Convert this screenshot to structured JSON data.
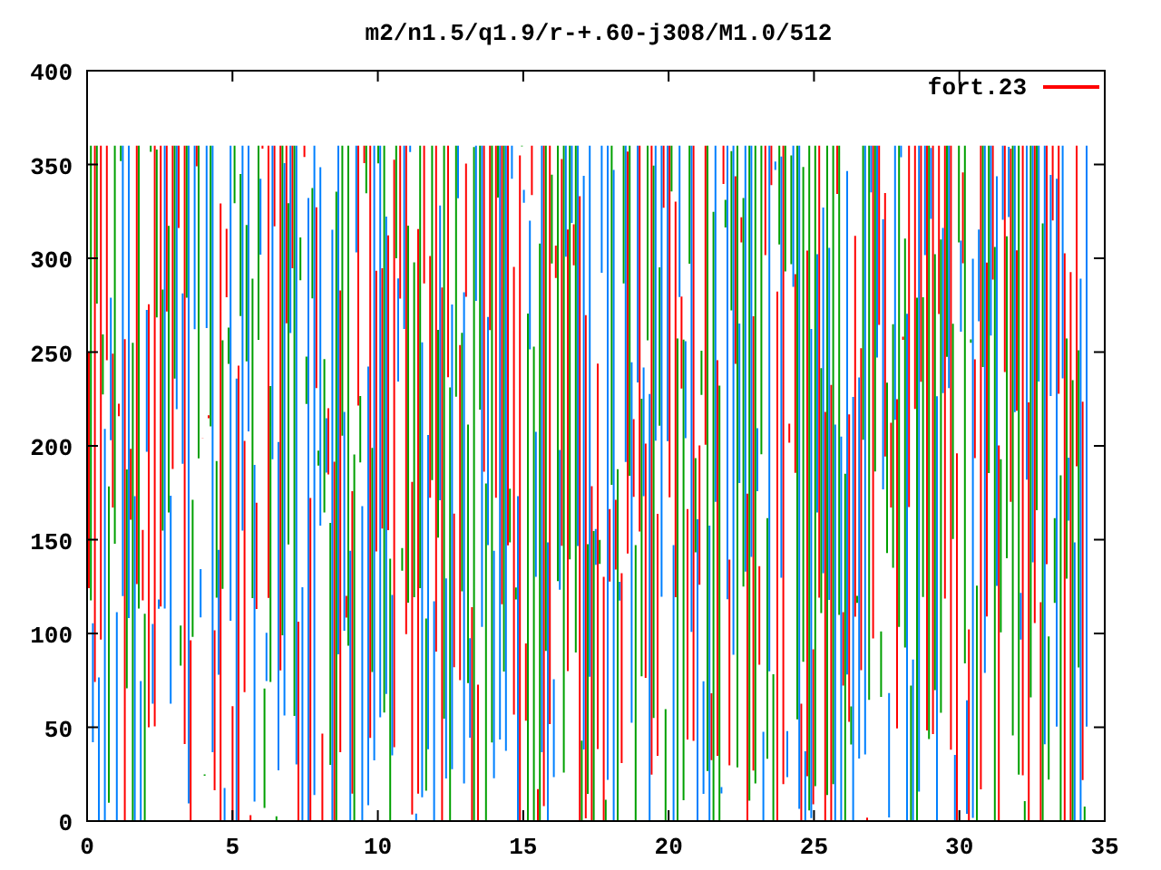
{
  "plot": {
    "title": "m2/n1.5/q1.9/r-+.60-j308/M1.0/512",
    "legend": [
      {
        "label": "fort.23",
        "color": "#ff0000"
      }
    ],
    "x_ticks": [
      "0",
      "5",
      "10",
      "15",
      "20",
      "25",
      "30",
      "35"
    ],
    "y_ticks": [
      "400",
      "350",
      "300",
      "250",
      "200",
      "150",
      "100",
      "50",
      "0"
    ]
  }
}
